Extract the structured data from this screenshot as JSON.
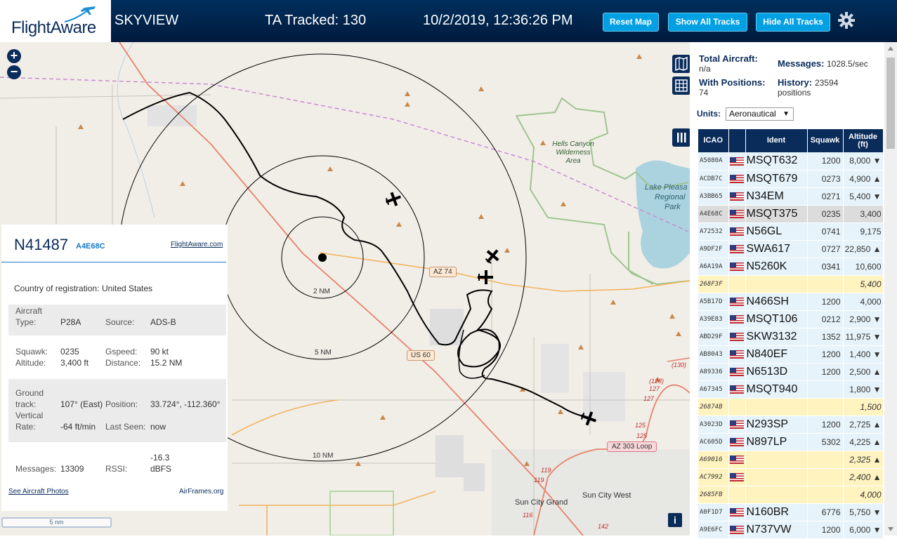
{
  "header": {
    "logo_text": "FlightAware",
    "app_name": "SKYVIEW",
    "tracked": "TA Tracked: 130",
    "datetime": "10/2/2019, 12:36:26 PM",
    "buttons": {
      "reset": "Reset Map",
      "show_all": "Show All Tracks",
      "hide_all": "Hide All Tracks"
    },
    "settings_icon": "gear-icon"
  },
  "map": {
    "zoom_in": "+",
    "zoom_out": "−",
    "range_rings": [
      "2 NM",
      "5 NM",
      "10 NM"
    ],
    "roads": [
      "AZ 74",
      "US 60",
      "AZ 303 Loop"
    ],
    "route_numbers": [
      "(130)",
      "(128)",
      "127",
      "127",
      "125",
      "125",
      "119",
      "119",
      "116",
      "142"
    ],
    "parks": [
      {
        "lines": [
          "Hells Canyon",
          "Wilderness",
          "Area"
        ]
      },
      {
        "lines": [
          "Lake Pleasa",
          "Regional",
          "Park"
        ]
      }
    ],
    "towns": [
      "Sun City Grand",
      "Sun City West"
    ],
    "scale": "5 nm",
    "info": "i",
    "colors": {
      "water": "#aad3df",
      "park_outline": "#9ec58f",
      "track": "#000000",
      "road_orange": "#f2b35c",
      "road_red": "#e8826a"
    }
  },
  "detail": {
    "ident": "N41487",
    "icao": "A4E68C",
    "link": "FlightAware.com",
    "country_label": "Country of registration:",
    "country": "United States",
    "aircraft_type_label": [
      "Aircraft",
      "Type:"
    ],
    "aircraft_type": "P28A",
    "source_label": "Source:",
    "source": "ADS-B",
    "squawk_label": "Squawk:",
    "squawk": "0235",
    "gspeed_label": "Gspeed:",
    "gspeed": "90 kt",
    "altitude_label": "Altitude:",
    "altitude": "3,400 ft",
    "distance_label": "Distance:",
    "distance": "15.2 NM",
    "ground_track_label": [
      "Ground",
      "track:"
    ],
    "ground_track": "107° (East)",
    "position_label": "Position:",
    "position": "33.724°, -112.360°",
    "vrate_label": [
      "Vertical",
      "Rate:"
    ],
    "vrate": "-64 ft/min",
    "last_seen_label": "Last Seen:",
    "last_seen": "now",
    "messages_label": "Messages:",
    "messages": "13309",
    "rssi_label": "RSSI:",
    "rssi": [
      "-16.3",
      "dBFS"
    ],
    "photos_link": "See Aircraft Photos",
    "airframes_link": "AirFrames.org"
  },
  "side": {
    "total_label": "Total Aircraft:",
    "total": "n/a",
    "messages_label": "Messages:",
    "messages": "1028.5/sec",
    "positions_label": "With Positions:",
    "positions": "74",
    "history_label": "History:",
    "history": [
      "23594",
      "positions"
    ],
    "units_label": "Units:",
    "units_value": "Aeronautical",
    "columns": [
      "ICAO",
      "",
      "Ident",
      "Squawk",
      "Altitude (ft)"
    ],
    "rows": [
      {
        "icao": "A5080A",
        "ident": "MSQT632",
        "squawk": "1200",
        "alt": "8,000 ▼",
        "hl": false
      },
      {
        "icao": "ACDB7C",
        "ident": "MSQT679",
        "squawk": "0273",
        "alt": "4,900 ▲",
        "hl": false
      },
      {
        "icao": "A3BB65",
        "ident": "N34EM",
        "squawk": "0271",
        "alt": "5,400 ▼",
        "hl": false
      },
      {
        "icao": "A4E68C",
        "ident": "MSQT375",
        "squawk": "0235",
        "alt": "3,400",
        "hl": false,
        "sel": true
      },
      {
        "icao": "A72532",
        "ident": "N56GL",
        "squawk": "0741",
        "alt": "9,175",
        "hl": false
      },
      {
        "icao": "A9DF2F",
        "ident": "SWA617",
        "squawk": "0727",
        "alt": "22,850 ▲",
        "hl": false
      },
      {
        "icao": "A6A19A",
        "ident": "N5260K",
        "squawk": "0341",
        "alt": "10,600",
        "hl": false
      },
      {
        "icao": "268F3F",
        "ident": "",
        "squawk": "",
        "alt": "5,400",
        "hl": true,
        "noflag": true
      },
      {
        "icao": "A5B17D",
        "ident": "N466SH",
        "squawk": "1200",
        "alt": "4,000",
        "hl": false
      },
      {
        "icao": "A39E83",
        "ident": "MSQT106",
        "squawk": "0212",
        "alt": "2,900 ▼",
        "hl": false
      },
      {
        "icao": "ABD29F",
        "ident": "SKW3132",
        "squawk": "1352",
        "alt": "11,975 ▼",
        "hl": false
      },
      {
        "icao": "AB8043",
        "ident": "N840EF",
        "squawk": "1200",
        "alt": "1,400 ▼",
        "hl": false
      },
      {
        "icao": "A89336",
        "ident": "N6513D",
        "squawk": "1200",
        "alt": "2,500 ▲",
        "hl": false
      },
      {
        "icao": "A67345",
        "ident": "MSQT940",
        "squawk": "",
        "alt": "1,800 ▼",
        "hl": false
      },
      {
        "icao": "26874B",
        "ident": "",
        "squawk": "",
        "alt": "1,500",
        "hl": true,
        "noflag": true
      },
      {
        "icao": "A3023D",
        "ident": "N293SP",
        "squawk": "1200",
        "alt": "2,725 ▲",
        "hl": false
      },
      {
        "icao": "AC605D",
        "ident": "N897LP",
        "squawk": "5302",
        "alt": "4,225 ▲",
        "hl": false
      },
      {
        "icao": "A69016",
        "ident": "",
        "squawk": "",
        "alt": "2,325 ▲",
        "hl": true
      },
      {
        "icao": "AC7992",
        "ident": "",
        "squawk": "",
        "alt": "2,400 ▲",
        "hl": true
      },
      {
        "icao": "2685FB",
        "ident": "",
        "squawk": "",
        "alt": "4,000",
        "hl": true,
        "noflag": true
      },
      {
        "icao": "A0F1D7",
        "ident": "N160BR",
        "squawk": "6776",
        "alt": "5,750 ▼",
        "hl": false
      },
      {
        "icao": "A9E6FC",
        "ident": "N737VW",
        "squawk": "1200",
        "alt": "6,000 ▼",
        "hl": false
      }
    ]
  }
}
